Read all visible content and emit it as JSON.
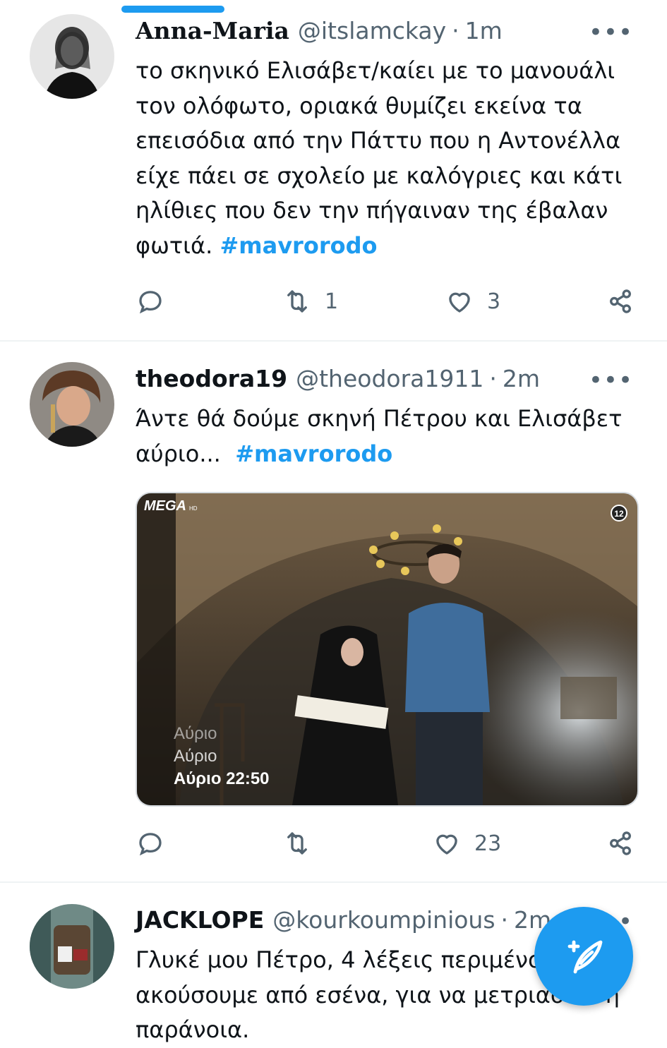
{
  "tweets": [
    {
      "name": "Anna-Maria",
      "handle": "@itslamckay",
      "time": "1m",
      "text_lines": [
        "το σκηνικό Ελισάβετ/καίει με το μανουάλι",
        "τον ολόφωτο, οριακά θυμίζει εκείνα τα",
        "επεισόδια από την Πάττυ που η Αντονέλλα",
        "είχε πάει σε σχολείο με καλόγριες και κάτι",
        "ηλίθιες που δεν την πήγαιναν της έβαλαν"
      ],
      "last_line_text": "φωτιά. ",
      "hashtag": "#mavrorodo",
      "retweets": "1",
      "likes": "3"
    },
    {
      "name": "theodora19",
      "handle": "@theodora1911",
      "time": "2m",
      "text_line1": "Άντε θά δούμε σκηνή Πέτρου και Ελισάβετ",
      "text_line2": "αύριο...  ",
      "hashtag": "#mavrorodo",
      "retweets": "",
      "likes": "23",
      "media": {
        "channel_logo": "MEGA",
        "channel_hd": "HD",
        "rating": "12",
        "overlay_lines": [
          "Αύριο",
          "Αύριο",
          "Αύριο 22:50"
        ]
      }
    },
    {
      "name": "JACKLOPE",
      "handle": "@kourkoumpinious",
      "time": "2m",
      "text_lines": [
        "Γλυκέ μου Πέτρο, 4 λέξεις περιμένουμε να",
        "ακούσουμε από εσένα, για να μετριαστεί η",
        "παράνοια."
      ]
    }
  ],
  "more_label": "•••",
  "accent_color": "#1d9bf0",
  "icons": [
    "reply-icon",
    "retweet-icon",
    "like-icon",
    "share-icon",
    "compose-tweet-icon"
  ]
}
